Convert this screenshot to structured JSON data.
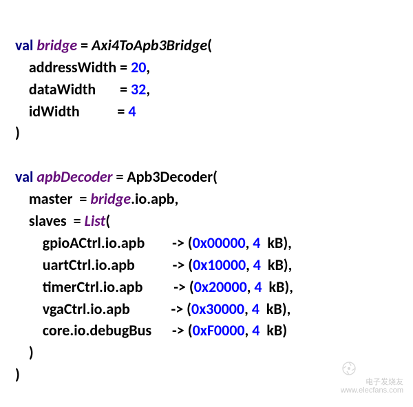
{
  "line1": {
    "kw": "val",
    "var": "bridge",
    "eq": " = ",
    "type": "Axi4ToApb3Bridge",
    "open": "("
  },
  "line2": {
    "indent": "    ",
    "name": "addressWidth",
    "pad": " ",
    "eq": "= ",
    "val": "20",
    "comma": ","
  },
  "line3": {
    "indent": "    ",
    "name": "dataWidth",
    "pad": "       ",
    "eq": "= ",
    "val": "32",
    "comma": ","
  },
  "line4": {
    "indent": "    ",
    "name": "idWidth",
    "pad": "           ",
    "eq": "= ",
    "val": "4"
  },
  "line5": {
    "close": ")"
  },
  "blank": " ",
  "line7": {
    "kw": "val",
    "var": "apbDecoder",
    "eq": " = ",
    "type": "Apb3Decoder",
    "open": "("
  },
  "line8": {
    "indent": "    ",
    "name": "master  = ",
    "var": "bridge",
    "rest": ".io.apb,"
  },
  "line9": {
    "indent": "    ",
    "name": "slaves  = ",
    "type": "List",
    "open": "("
  },
  "slaves": [
    {
      "indent": "        ",
      "ident": "gpioACtrl.io.apb",
      "pad": "        ",
      "arrow": "-> (",
      "addr": "0x00000",
      "sep1": ", ",
      "size": "4",
      "sep2": "  ",
      "unit": "kB",
      "close": "),"
    },
    {
      "indent": "        ",
      "ident": "uartCtrl.io.apb",
      "pad": "           ",
      "arrow": "-> (",
      "addr": "0x10000",
      "sep1": ", ",
      "size": "4",
      "sep2": "  ",
      "unit": "kB",
      "close": "),"
    },
    {
      "indent": "        ",
      "ident": "timerCtrl.io.apb",
      "pad": "         ",
      "arrow": "-> (",
      "addr": "0x20000",
      "sep1": ", ",
      "size": "4",
      "sep2": "  ",
      "unit": "kB",
      "close": "),"
    },
    {
      "indent": "        ",
      "ident": "vgaCtrl.io.apb",
      "pad": "            ",
      "arrow": "-> (",
      "addr": "0x30000",
      "sep1": ", ",
      "size": "4",
      "sep2": "  ",
      "unit": "kB",
      "close": "),"
    },
    {
      "indent": "        ",
      "ident": "core.io.debugBus",
      "pad": "      ",
      "arrow": "-> (",
      "addr": "0xF0000",
      "sep1": ", ",
      "size": "4",
      "sep2": "  ",
      "unit": "kB",
      "close": ")"
    }
  ],
  "line15": {
    "indent": "    ",
    "close": ")"
  },
  "line16": {
    "close": ")"
  },
  "watermark": {
    "brand": "电子发烧友",
    "url": "www.elecfans.com"
  }
}
